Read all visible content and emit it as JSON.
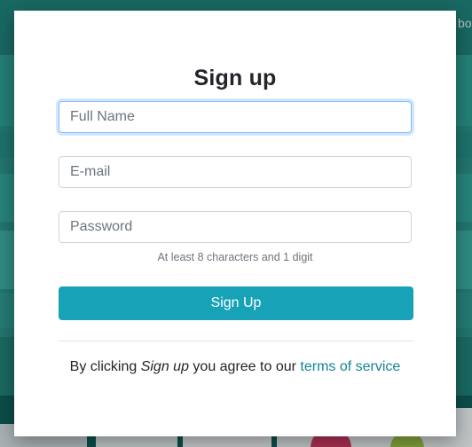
{
  "background": {
    "partial_text": "bo"
  },
  "modal": {
    "title": "Sign up",
    "fields": {
      "full_name": {
        "placeholder": "Full Name",
        "value": ""
      },
      "email": {
        "placeholder": "E-mail",
        "value": ""
      },
      "password": {
        "placeholder": "Password",
        "value": ""
      }
    },
    "password_hint": "At least 8 characters and 1 digit",
    "submit_label": "Sign Up",
    "terms": {
      "prefix": "By clicking ",
      "emphasis": "Sign up",
      "middle": " you agree to our ",
      "link": "terms of service"
    }
  },
  "colors": {
    "accent": "#17a2b8",
    "link": "#138496",
    "background_teal": "#2a8f86"
  }
}
